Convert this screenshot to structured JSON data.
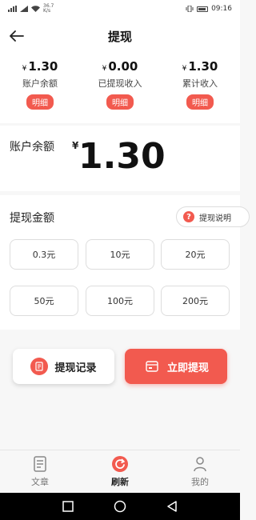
{
  "status_bar": {
    "speed_value": "36.7",
    "speed_unit": "K/s",
    "time": "09:16"
  },
  "nav": {
    "title": "提现"
  },
  "stats": [
    {
      "currency": "¥",
      "value": "1.30",
      "label": "账户余额",
      "detail_label": "明细"
    },
    {
      "currency": "¥",
      "value": "0.00",
      "label": "已提现收入",
      "detail_label": "明细"
    },
    {
      "currency": "¥",
      "value": "1.30",
      "label": "累计收入",
      "detail_label": "明细"
    }
  ],
  "balance": {
    "label": "账户余额",
    "currency": "¥",
    "amount": "1.30"
  },
  "withdraw_amount": {
    "title": "提现金额",
    "help_label": "提现说明",
    "options": [
      "0.3元",
      "10元",
      "20元",
      "50元",
      "100元",
      "200元"
    ]
  },
  "actions": {
    "record_label": "提现记录",
    "withdraw_label": "立即提现"
  },
  "tabbar": {
    "items": [
      {
        "label": "文章",
        "icon": "article-icon"
      },
      {
        "label": "刷新",
        "icon": "refresh-icon"
      },
      {
        "label": "我的",
        "icon": "profile-icon"
      }
    ]
  },
  "colors": {
    "accent": "#f25a4f"
  }
}
